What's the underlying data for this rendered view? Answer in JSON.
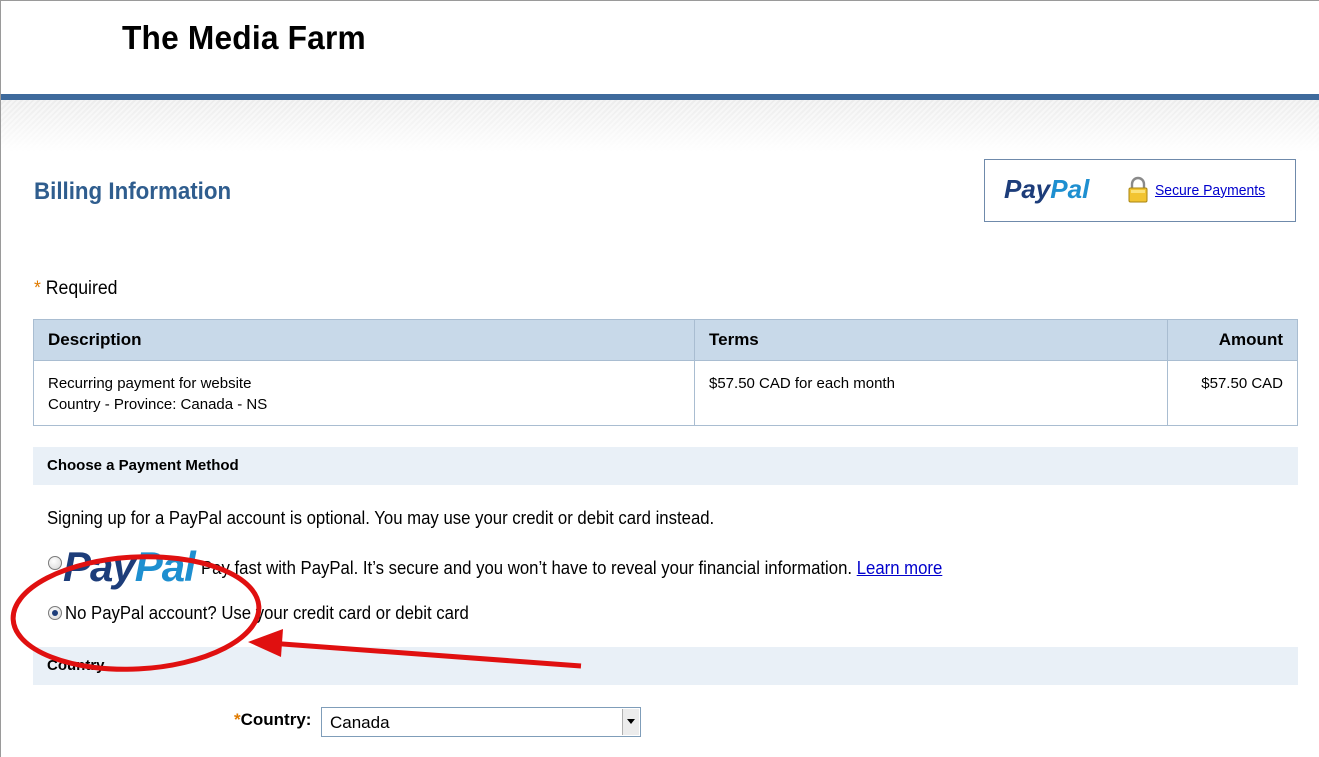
{
  "merchant": {
    "name": "The Media Farm"
  },
  "billing": {
    "title": "Billing Information"
  },
  "paypal_box": {
    "logo_pay": "Pay",
    "logo_pal": "Pal",
    "secure_link": "Secure Payments"
  },
  "required": {
    "star": "*",
    "label": "Required"
  },
  "items_table": {
    "headers": {
      "description": "Description",
      "terms": "Terms",
      "amount": "Amount"
    },
    "rows": [
      {
        "description_line1": "Recurring payment for website",
        "description_line2": "Country - Province: Canada - NS",
        "terms": "$57.50 CAD for each month",
        "amount": "$57.50 CAD"
      }
    ]
  },
  "payment_method": {
    "heading": "Choose a Payment Method",
    "optional_text": "Signing up for a PayPal account is optional. You may use your credit or debit card instead.",
    "paypal_option": {
      "logo_pay": "Pay",
      "logo_pal": "Pal",
      "text": "Pay fast with PayPal. It’s secure and you won’t have to reveal your financial information.",
      "learn_more": "Learn more",
      "checked": false
    },
    "card_option": {
      "text": "No PayPal account? Use your credit card or debit card",
      "checked": true
    }
  },
  "country_section": {
    "heading": "Country",
    "star": "*",
    "label": "Country:",
    "selected": "Canada"
  },
  "colors": {
    "header_rule": "#3e6a9c",
    "title_blue": "#2f5d8e",
    "table_header": "#c8d9e9",
    "section_bar": "#e9f0f7",
    "required_star": "#e07b00",
    "annotation_red": "#e01010"
  },
  "icons": [
    "lock-icon",
    "select-arrow-icon"
  ]
}
